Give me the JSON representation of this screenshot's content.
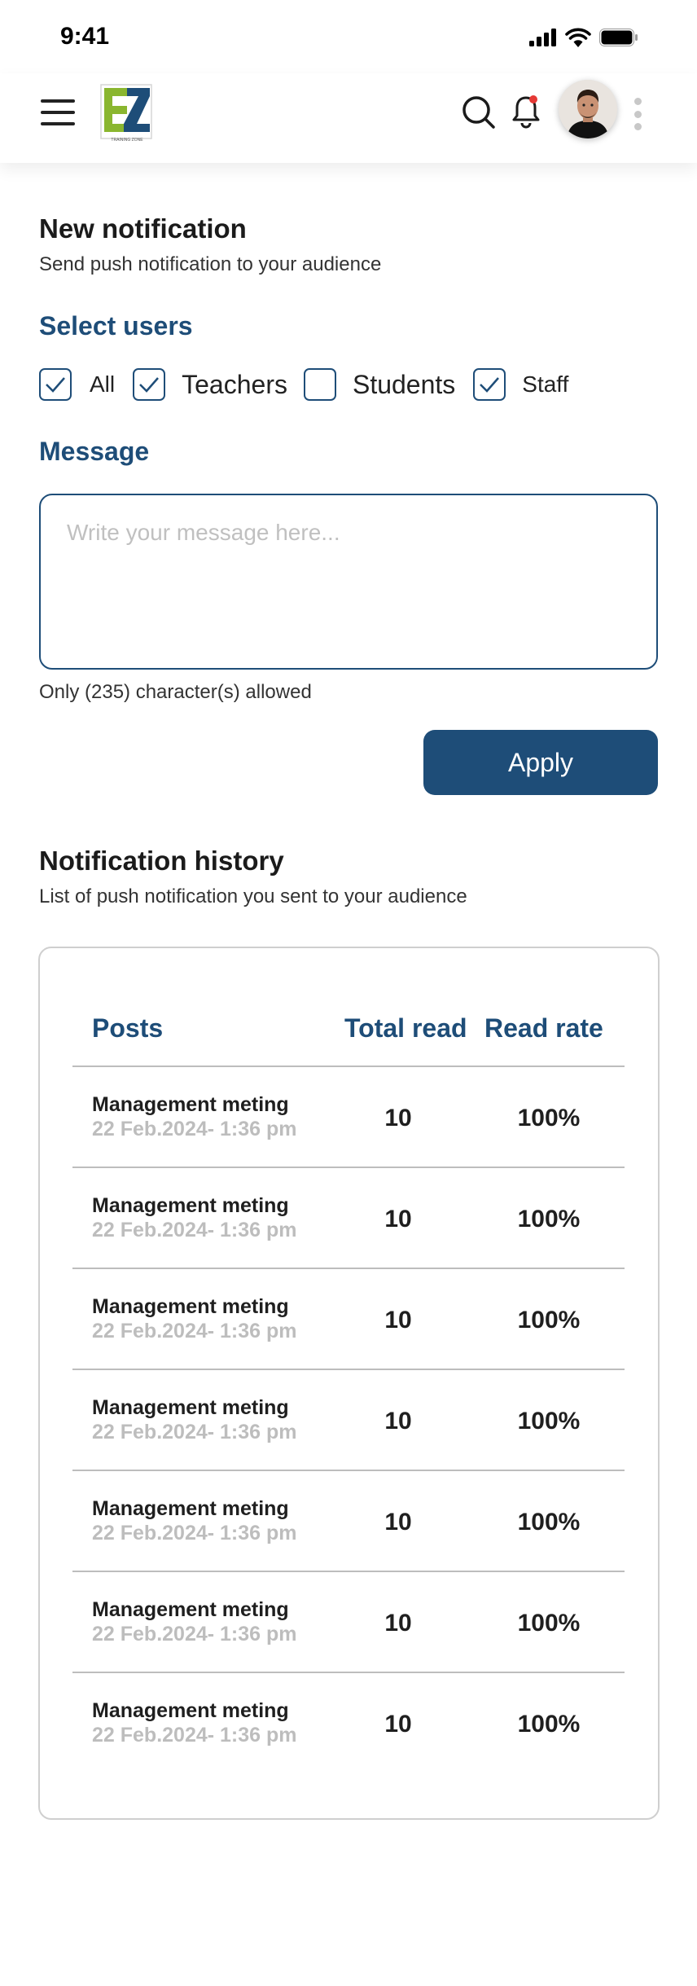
{
  "status_bar": {
    "time": "9:41"
  },
  "header": {
    "logo_text": "EZ",
    "logo_tagline": "TRAINING ZONE",
    "icons": [
      "menu-icon",
      "search-icon",
      "bell-icon",
      "kebab-menu-icon"
    ],
    "notification_dot_color": "#e53935"
  },
  "new_notification": {
    "title": "New notification",
    "subtitle": "Send push notification to your audience",
    "select_users_heading": "Select users",
    "users": [
      {
        "label": "All",
        "checked": true
      },
      {
        "label": "Teachers",
        "checked": true
      },
      {
        "label": "Students",
        "checked": false
      },
      {
        "label": "Staff",
        "checked": true
      }
    ],
    "message_heading": "Message",
    "message_placeholder": "Write your message here...",
    "message_value": "",
    "char_limit_note": "Only (235) character(s) allowed",
    "apply_label": "Apply"
  },
  "history": {
    "title": "Notification history",
    "subtitle": "List of  push notification you sent to your audience",
    "columns": [
      "Posts",
      "Total read",
      "Read rate"
    ],
    "rows": [
      {
        "title": "Management meting",
        "date": "22 Feb.2024- 1:36 pm",
        "total_read": "10",
        "read_rate": "100%"
      },
      {
        "title": "Management meting",
        "date": "22 Feb.2024- 1:36 pm",
        "total_read": "10",
        "read_rate": "100%"
      },
      {
        "title": "Management meting",
        "date": "22 Feb.2024- 1:36 pm",
        "total_read": "10",
        "read_rate": "100%"
      },
      {
        "title": "Management meting",
        "date": "22 Feb.2024- 1:36 pm",
        "total_read": "10",
        "read_rate": "100%"
      },
      {
        "title": "Management meting",
        "date": "22 Feb.2024- 1:36 pm",
        "total_read": "10",
        "read_rate": "100%"
      },
      {
        "title": "Management meting",
        "date": "22 Feb.2024- 1:36 pm",
        "total_read": "10",
        "read_rate": "100%"
      },
      {
        "title": "Management meting",
        "date": "22 Feb.2024- 1:36 pm",
        "total_read": "10",
        "read_rate": "100%"
      }
    ]
  },
  "colors": {
    "primary": "#1e4d78",
    "logo_green": "#8ab62f",
    "logo_blue": "#1e4d78",
    "muted_text": "#bdbdbd",
    "divider": "#bdbdbd"
  }
}
